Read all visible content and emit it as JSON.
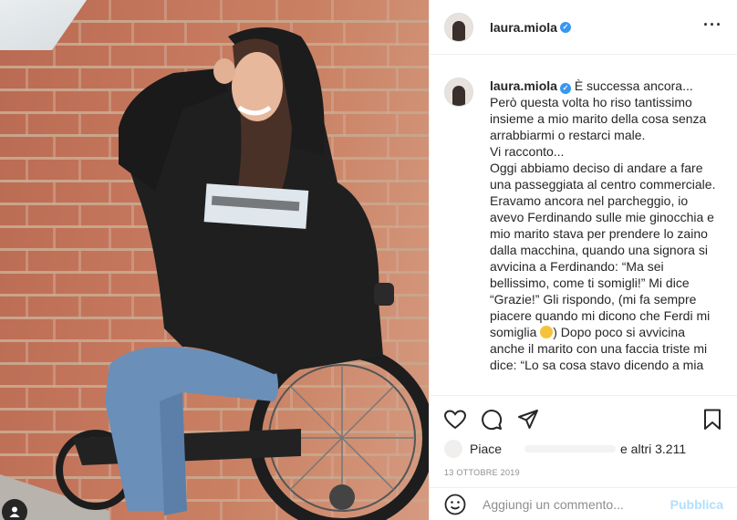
{
  "post": {
    "username": "laura.miola",
    "more_icon": "more-horizontal-icon",
    "caption_lines": [
      "È successa ancora...",
      "Però questa volta ho riso tantissimo insieme a mio marito della cosa senza arrabbiarmi o restarci male.",
      "Vi racconto...",
      "Oggi abbiamo deciso di andare a fare una passeggiata al centro commerciale. Eravamo ancora nel parcheggio, io avevo Ferdinando sulle mie ginocchia e mio marito stava per prendere lo zaino dalla macchina, quando una signora si avvicina a Ferdinando: “Ma sei bellissimo, come ti somigli!” Mi dice “Grazie!” Gli rispondo, (mi fa sempre piacere quando mi dicono che Ferdi mi somiglia",
      ") Dopo poco si avvicina anche il marito con una faccia triste mi dice: “Lo sa cosa stavo dicendo a mia"
    ],
    "likes_prefix": "Piace",
    "likes_suffix": "e altri 3.211",
    "date": "13 OTTOBRE 2019"
  },
  "actions": {
    "like_icon": "heart-icon",
    "comment_icon": "comment-icon",
    "share_icon": "paper-plane-icon",
    "save_icon": "bookmark-icon"
  },
  "comment_bar": {
    "emoji_icon": "emoji-smile-icon",
    "placeholder": "Aggiungi un commento...",
    "publish_label": "Pubblica"
  },
  "colors": {
    "verified": "#3897f0",
    "publish_disabled": "#b2dffc",
    "muted_text": "#8e8e8e"
  }
}
